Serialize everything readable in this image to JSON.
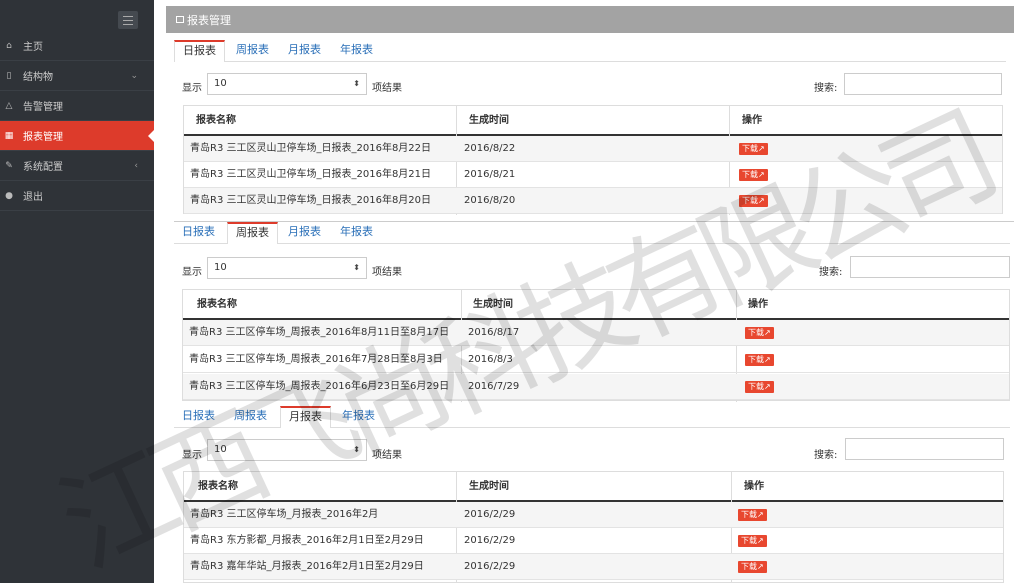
{
  "sidebar": {
    "items": [
      {
        "label": "主页",
        "icon": "home-icon"
      },
      {
        "label": "结构物",
        "icon": "file-icon",
        "chevron": "⌄"
      },
      {
        "label": "告警管理",
        "icon": "bell-icon"
      },
      {
        "label": "报表管理",
        "icon": "table-icon",
        "active": true
      },
      {
        "label": "系统配置",
        "icon": "wrench-icon",
        "chevron": "‹"
      },
      {
        "label": "退出",
        "icon": "user-icon"
      }
    ]
  },
  "header": {
    "title": "报表管理"
  },
  "controls": {
    "show_label": "显示",
    "page_size": "10",
    "show_suffix": "项结果",
    "search_label": "搜索:"
  },
  "panels": [
    {
      "tabs": [
        "日报表",
        "周报表",
        "月报表",
        "年报表"
      ],
      "active_tab": 0,
      "columns": [
        "报表名称",
        "生成时间",
        "操作"
      ],
      "rows": [
        {
          "name": "青岛R3 三工区灵山卫停车场_日报表_2016年8月22日",
          "time": "2016/8/22",
          "action": "下载"
        },
        {
          "name": "青岛R3 三工区灵山卫停车场_日报表_2016年8月21日",
          "time": "2016/8/21",
          "action": "下载"
        },
        {
          "name": "青岛R3 三工区灵山卫停车场_日报表_2016年8月20日",
          "time": "2016/8/20",
          "action": "下载"
        }
      ]
    },
    {
      "tabs": [
        "日报表",
        "周报表",
        "月报表",
        "年报表"
      ],
      "active_tab": 1,
      "columns": [
        "报表名称",
        "生成时间",
        "操作"
      ],
      "rows": [
        {
          "name": "青岛R3 三工区停车场_周报表_2016年8月11日至8月17日",
          "time": "2016/8/17",
          "action": "下载"
        },
        {
          "name": "青岛R3 三工区停车场_周报表_2016年7月28日至8月3日",
          "time": "2016/8/3",
          "action": "下载"
        },
        {
          "name": "青岛R3 三工区停车场_周报表_2016年6月23日至6月29日",
          "time": "2016/7/29",
          "action": "下载"
        }
      ]
    },
    {
      "tabs": [
        "日报表",
        "周报表",
        "月报表",
        "年报表"
      ],
      "active_tab": 2,
      "columns": [
        "报表名称",
        "生成时间",
        "操作"
      ],
      "rows": [
        {
          "name": "青岛R3 三工区停车场_月报表_2016年2月",
          "time": "2016/2/29",
          "action": "下载"
        },
        {
          "name": "青岛R3 东方影都_月报表_2016年2月1日至2月29日",
          "time": "2016/2/29",
          "action": "下载"
        },
        {
          "name": "青岛R3 嘉年华站_月报表_2016年2月1日至2月29日",
          "time": "2016/2/29",
          "action": "下载"
        }
      ]
    }
  ],
  "watermark": "江西飞尚科技有限公司"
}
